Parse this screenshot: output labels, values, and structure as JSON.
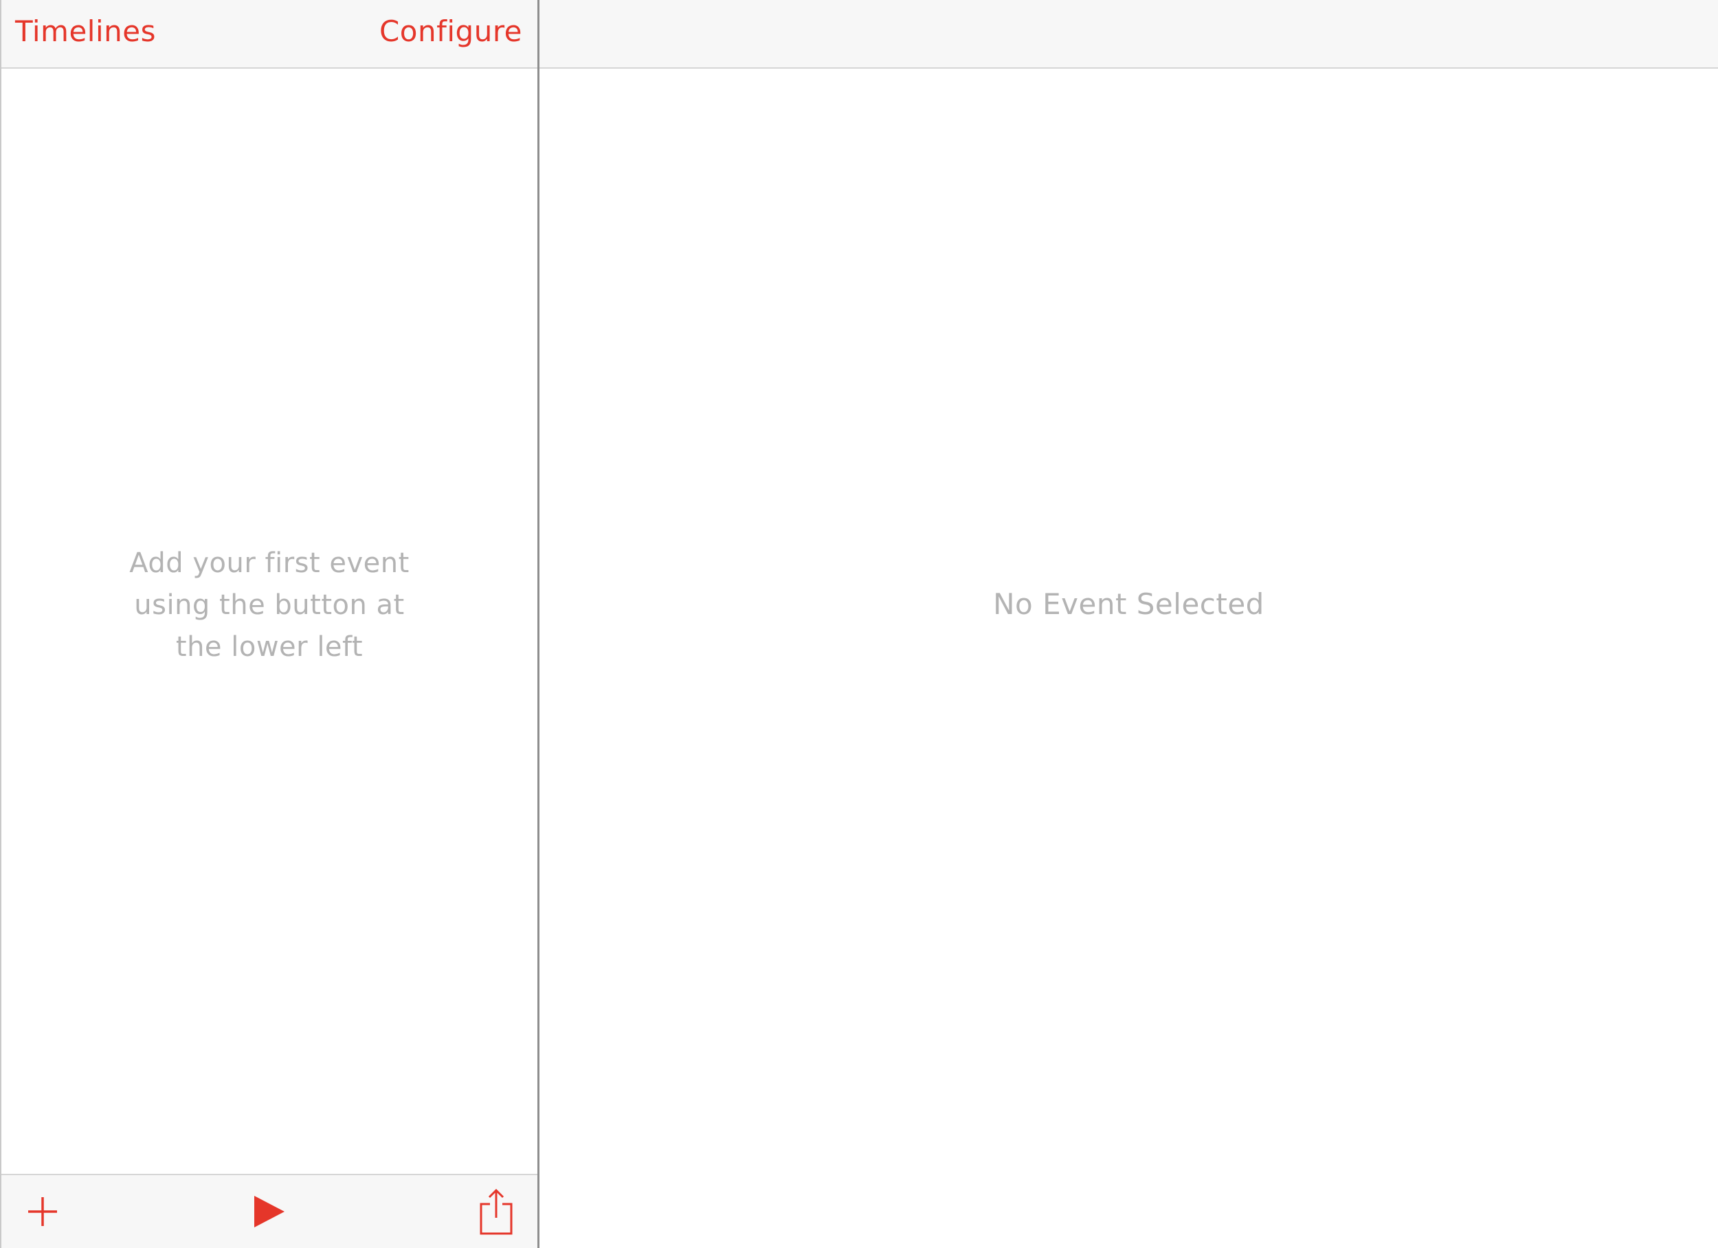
{
  "sidebar": {
    "nav": {
      "left_label": "Timelines",
      "right_label": "Configure"
    },
    "empty_hint": {
      "line1": "Add your first event",
      "line2": "using the button at",
      "line3": "the lower left"
    },
    "toolbar": {
      "add_icon": "plus-icon",
      "play_icon": "play-icon",
      "share_icon": "share-icon"
    }
  },
  "detail": {
    "empty_text": "No Event Selected"
  },
  "colors": {
    "accent": "#e5362a",
    "placeholder_text": "#b3b3b3",
    "bar_background": "#f7f7f7"
  }
}
